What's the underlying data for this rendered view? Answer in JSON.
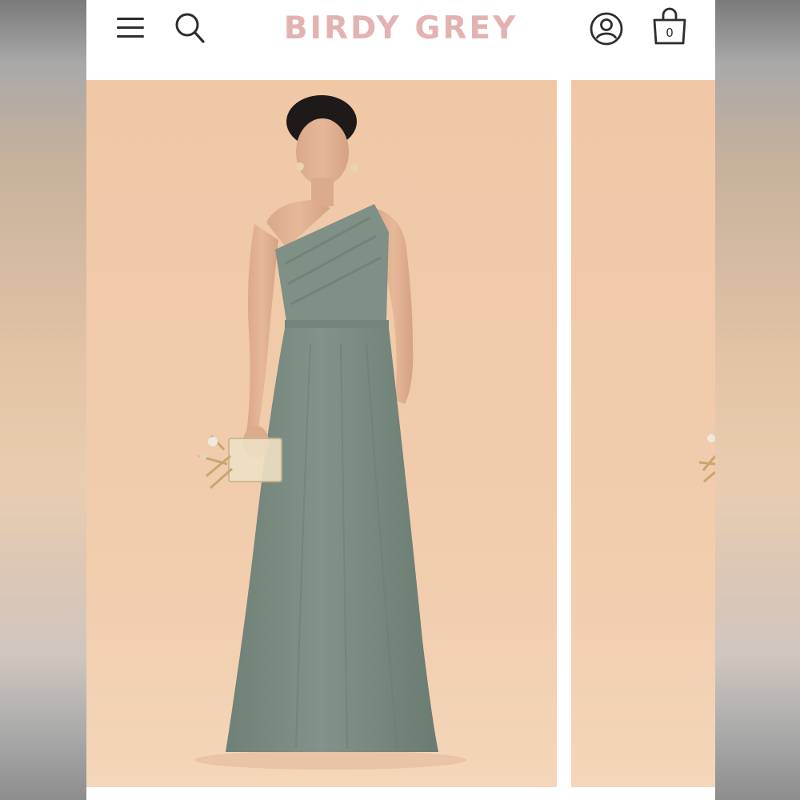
{
  "brand": {
    "logo_text": "BIRDY GREY",
    "logo_color": "#e3b3b1"
  },
  "header": {
    "menu_icon": "hamburger-menu-icon",
    "search_icon": "search-icon",
    "account_icon": "account-icon",
    "bag_icon": "shopping-bag-icon",
    "bag_count": "0"
  },
  "product_gallery": {
    "background_color": "#f0c9a8",
    "dress_color": "#7b8b81",
    "images": [
      {
        "alt": "one-shoulder-chiffon-dress-photo"
      },
      {
        "alt": "next-product-photo"
      }
    ]
  }
}
